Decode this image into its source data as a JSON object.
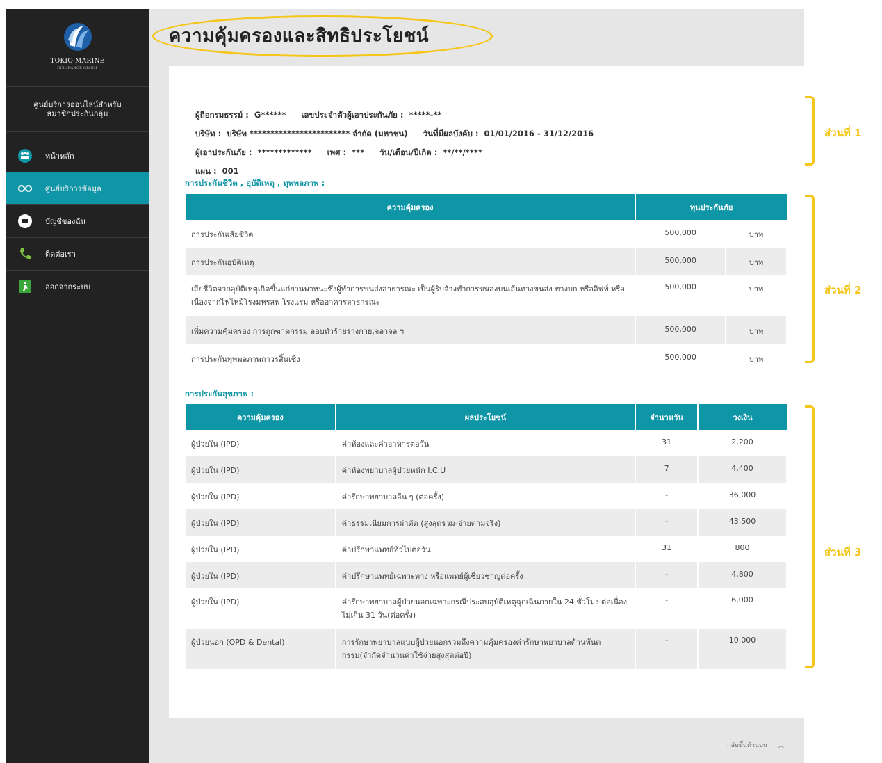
{
  "sidebar": {
    "brand": "TOKIO MARINE",
    "brand_sub": "INSURANCE GROUP",
    "title_line1": "ศูนย์บริการออนไลน์สำหรับ",
    "title_line2": "สมาชิกประกันกลุ่ม",
    "items": [
      {
        "label": "หน้าหลัก",
        "icon": "family-icon",
        "active": false
      },
      {
        "label": "ศูนย์บริการข้อมูล",
        "icon": "glasses-icon",
        "active": true
      },
      {
        "label": "บัญชีของฉัน",
        "icon": "card-icon",
        "active": false
      },
      {
        "label": "ติดต่อเรา",
        "icon": "phone-icon",
        "active": false
      },
      {
        "label": "ออกจากระบบ",
        "icon": "exit-icon",
        "active": false
      }
    ]
  },
  "page": {
    "title": "ความคุ้มครองและสิทธิประโยชน์",
    "back_to_top": "กลับขึ้นด้านบน"
  },
  "info": {
    "policy_holder_label": "ผู้ถือกรมธรรม์ :",
    "policy_holder": "G******",
    "insured_id_label": "เลขประจำตัวผู้เอาประกันภัย :",
    "insured_id": "*****-**",
    "company_label": "บริษัท :",
    "company": "บริษัท ************************ จำกัด (มหาชน)",
    "effective_label": "วันที่มีผลบังคับ :",
    "effective": "01/01/2016 - 31/12/2016",
    "insured_label": "ผู้เอาประกันภัย :",
    "insured": "*************",
    "gender_label": "เพศ :",
    "gender": "***",
    "dob_label": "วัน/เดือน/ปีเกิด :",
    "dob": "**/**/****",
    "plan_label": "แผน :",
    "plan": "001"
  },
  "life": {
    "section_label": "การประกันชีวิต , อุบัติเหตุ , ทุพพลภาพ :",
    "headers": [
      "ความคุ้มครอง",
      "ทุนประกันภัย"
    ],
    "rows": [
      {
        "coverage": "การประกันเสียชีวิต",
        "amount": "500,000",
        "unit": "บาท"
      },
      {
        "coverage": "การประกันอุบัติเหตุ",
        "amount": "500,000",
        "unit": "บาท"
      },
      {
        "coverage": "เสียชีวิตจากอุบัติเหตุเกิดขึ้นแก่ยานพาหนะซึ่งผู้ทำการขนส่งสาธารณะ เป็นผู้รับจ้างทำการขนส่งบนเส้นทางขนส่ง ทางบก หรือลิฟท์ หรือเนื่องจากไฟไหม้โรงมหรสพ โรงแรม หรืออาคารสาธารณะ",
        "amount": "500,000",
        "unit": "บาท"
      },
      {
        "coverage": "เพิ่มความคุ้มครอง การถูกฆาตกรรม ลอบทำร้ายร่างกาย,จลาจล ฯ",
        "amount": "500,000",
        "unit": "บาท"
      },
      {
        "coverage": "การประกันทุพพลภาพถาวรสิ้นเชิง",
        "amount": "500,000",
        "unit": "บาท"
      }
    ]
  },
  "health": {
    "section_label": "การประกันสุขภาพ :",
    "headers": [
      "ความคุ้มครอง",
      "ผลประโยชน์",
      "จำนวนวัน",
      "วงเงิน"
    ],
    "rows": [
      {
        "coverage": "ผู้ป่วยใน (IPD)",
        "benefit": "ค่าห้องและค่าอาหารต่อวัน",
        "days": "31",
        "limit": "2,200"
      },
      {
        "coverage": "ผู้ป่วยใน (IPD)",
        "benefit": "ค่าห้องพยาบาลผู้ป่วยหนัก I.C.U",
        "days": "7",
        "limit": "4,400"
      },
      {
        "coverage": "ผู้ป่วยใน (IPD)",
        "benefit": "ค่ารักษาพยาบาลอื่น ๆ (ต่อครั้ง)",
        "days": "-",
        "limit": "36,000"
      },
      {
        "coverage": "ผู้ป่วยใน (IPD)",
        "benefit": "ค่าธรรมเนียมการผ่าตัด (สูงสุดรวม-จ่ายตามจริง)",
        "days": "-",
        "limit": "43,500"
      },
      {
        "coverage": "ผู้ป่วยใน (IPD)",
        "benefit": "ค่าปรึกษาแพทย์ทั่วไปต่อวัน",
        "days": "31",
        "limit": "800"
      },
      {
        "coverage": "ผู้ป่วยใน (IPD)",
        "benefit": "ค่าปรึกษาแพทย์เฉพาะทาง หรือแพทย์ผู้เชี่ยวชาญต่อครั้ง",
        "days": "-",
        "limit": "4,800"
      },
      {
        "coverage": "ผู้ป่วยใน (IPD)",
        "benefit": "ค่ารักษาพยาบาลผู้ป่วยนอกเฉพาะกรณีประสบอุบัติเหตุฉุกเฉินภายใน 24 ชั่วโมง ต่อเนื่องไม่เกิน 31 วัน(ต่อครั้ง)",
        "days": "-",
        "limit": "6,000"
      },
      {
        "coverage": "ผู้ป่วยนอก (OPD & Dental)",
        "benefit": "การรักษาพยาบาลแบบผู้ป่วยนอกรวมถึงความคุ้มครองค่ารักษาพยาบาลด้านทันตกรรม(จำกัดจำนวนค่าใช้จ่ายสูงสุดต่อปี)",
        "days": "-",
        "limit": "10,000"
      }
    ]
  },
  "annotations": {
    "part1": "ส่วนที่ 1",
    "part2": "ส่วนที่ 2",
    "part3": "ส่วนที่ 3",
    "highlight_color": "#f5c518"
  },
  "colors": {
    "accent": "#0e95a6",
    "sidebar_bg": "#222222"
  }
}
